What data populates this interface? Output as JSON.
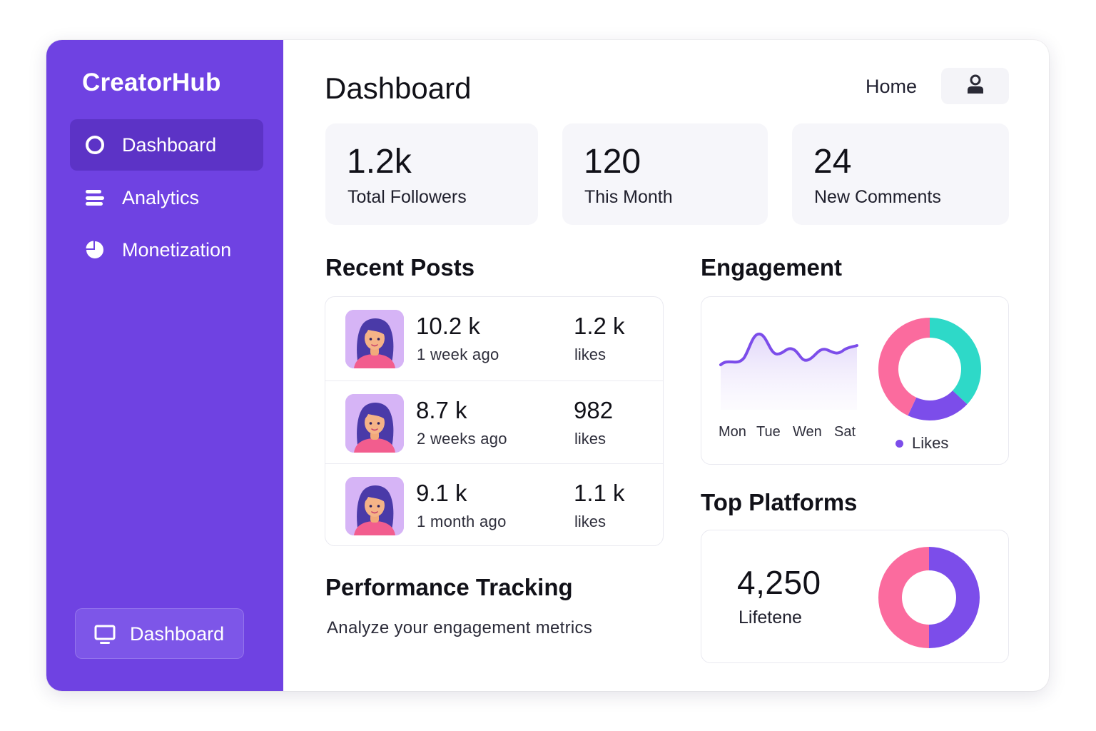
{
  "brand": {
    "name": "CreatorHub"
  },
  "sidebar": {
    "items": [
      {
        "label": "Dashboard",
        "icon": "circle-icon",
        "active": true
      },
      {
        "label": "Analytics",
        "icon": "bars-icon",
        "active": false
      },
      {
        "label": "Monetization",
        "icon": "pie-chart-icon",
        "active": false
      }
    ],
    "bottom_button": {
      "label": "Dashboard",
      "icon": "monitor-icon"
    }
  },
  "header": {
    "title": "Dashboard",
    "home_link": "Home",
    "profile_icon": "user-icon"
  },
  "stats": [
    {
      "value": "1.2k",
      "label": "Total Followers"
    },
    {
      "value": "120",
      "label": "This Month"
    },
    {
      "value": "24",
      "label": "New Comments"
    }
  ],
  "recent_posts": {
    "title": "Recent Posts",
    "items": [
      {
        "views": "10.2 k",
        "age": "1 week ago",
        "likes": "1.2 k",
        "likes_label": "likes"
      },
      {
        "views": "8.7 k",
        "age": "2 weeks ago",
        "likes": "982",
        "likes_label": "likes"
      },
      {
        "views": "9.1 k",
        "age": "1 month ago",
        "likes": "1.1 k",
        "likes_label": "likes"
      }
    ]
  },
  "engagement": {
    "title": "Engagement",
    "days": [
      "Mon",
      "Tue",
      "Wen",
      "Sat"
    ],
    "legend": "Likes",
    "donut": [
      {
        "name": "teal",
        "fraction": 0.37,
        "color": "#2ed9c8"
      },
      {
        "name": "purple",
        "fraction": 0.2,
        "color": "#7c4dea"
      },
      {
        "name": "pink",
        "fraction": 0.43,
        "color": "#fb6b9e"
      }
    ]
  },
  "top_platforms": {
    "title": "Top Platforms",
    "value": "4,250",
    "label": "Lifetene",
    "donut": [
      {
        "name": "purple",
        "fraction": 0.5,
        "color": "#7c4dea"
      },
      {
        "name": "pink",
        "fraction": 0.5,
        "color": "#fb6b9e"
      }
    ]
  },
  "performance": {
    "title": "Performance Tracking",
    "subtitle": "Analyze your engagement metrics"
  },
  "colors": {
    "sidebar": "#6f42e2",
    "sidebar_active": "#5c33c6",
    "accent_purple": "#7c4dea",
    "accent_pink": "#fb6b9e",
    "accent_teal": "#2ed9c8"
  }
}
